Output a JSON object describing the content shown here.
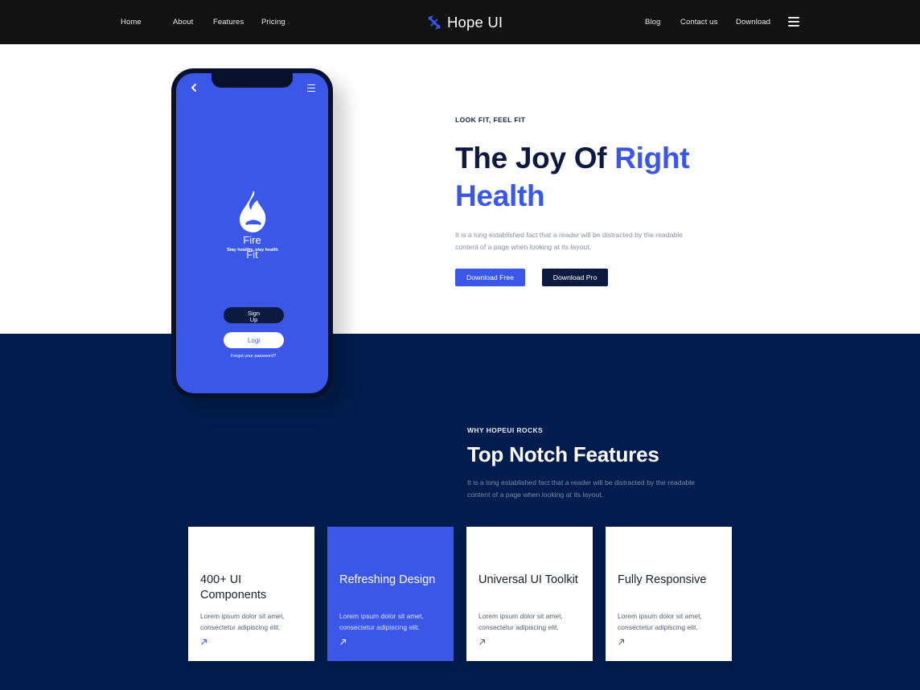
{
  "nav": {
    "left": [
      "Home",
      "About",
      "Features",
      "Pricing"
    ],
    "right": [
      "Blog",
      "Contact us",
      "Download"
    ],
    "brand": "Hope UI",
    "menu_icon": "hamburger-icon"
  },
  "hero": {
    "eyebrow": "LOOK FIT, FEEL FIT",
    "title_part1": "The Joy Of ",
    "title_accent": "Right",
    "title_part2": "Health",
    "description": "It is a long established fact that a reader will be distracted by the readable content of a page when looking at its layout.",
    "btn_free": "Download Free",
    "btn_pro": "Download Pro"
  },
  "phone": {
    "app_name": "Fire",
    "app_name2": "Fit",
    "tagline": "Stay healthy, stay health",
    "signup": "Sign Up",
    "login": "Logi",
    "forgot": "Forgot your password?"
  },
  "features": {
    "eyebrow": "WHY HOPEUI ROCKS",
    "title": "Top Notch Features",
    "description": "It is a long established fact that a reader will be distracted by the readable content of a page when looking at its layout.",
    "cards": [
      {
        "title": "400+ UI Components",
        "text": "Lorem ipsum dolor sit amet, consectetur adipiscing elit.",
        "icon": "arrow-up-right-icon"
      },
      {
        "title": "Refreshing Design",
        "text": "Lorem ipsum dolor sit amet, consectetur adipiscing elit.",
        "icon": "arrow-up-right-icon"
      },
      {
        "title": "Universal UI Toolkit",
        "text": "Lorem ipsum dolor sit amet, consectetur adipiscing elit.",
        "icon": "arrow-up-right-icon"
      },
      {
        "title": "Fully Responsive",
        "text": "Lorem ipsum dolor sit amet, consectetur adipiscing elit.",
        "icon": "arrow-up-right-icon"
      }
    ]
  },
  "colors": {
    "primary": "#3a57e8",
    "dark_navy": "#021d4d",
    "topbar": "#121212",
    "ink": "#0c1a40"
  }
}
